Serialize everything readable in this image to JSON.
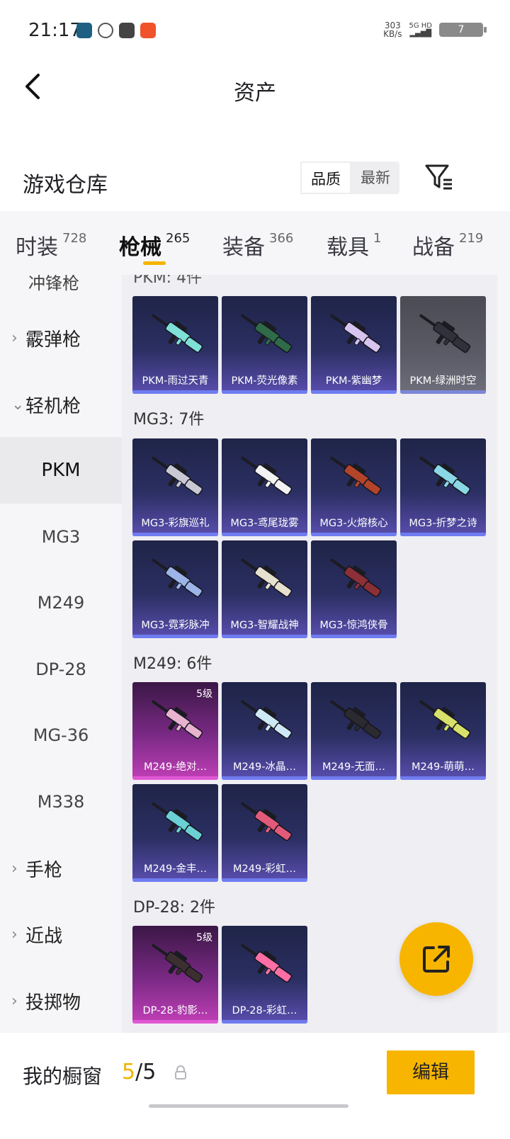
{
  "status_bar": {
    "time": "21:17",
    "net_speed_value": "303",
    "net_speed_unit": "KB/s",
    "signal": "5G HD",
    "battery": "7"
  },
  "nav": {
    "title": "资产"
  },
  "warehouse": {
    "title": "游戏仓库",
    "sort_options": [
      "品质",
      "最新"
    ],
    "sort_selected": "品质"
  },
  "tabs": [
    {
      "label": "时装",
      "count": "728"
    },
    {
      "label": "枪械",
      "count": "265"
    },
    {
      "label": "装备",
      "count": "366"
    },
    {
      "label": "载具",
      "count": "1"
    },
    {
      "label": "战备",
      "count": "219"
    }
  ],
  "active_tab": "枪械",
  "sidebar": {
    "partial_top": "冲锋枪",
    "groups": [
      {
        "label": "霰弹枪",
        "expanded": false
      },
      {
        "label": "轻机枪",
        "expanded": true
      },
      {
        "label": "手枪",
        "expanded": false
      },
      {
        "label": "近战",
        "expanded": false
      },
      {
        "label": "投掷物",
        "expanded": false
      }
    ],
    "sub_items": [
      "PKM",
      "MG3",
      "M249",
      "DP-28",
      "MG-36",
      "M338"
    ],
    "active_sub": "PKM"
  },
  "content": {
    "partial_section": "PKM: 4件",
    "sections": [
      {
        "title": "PKM: 4件",
        "items": [
          {
            "name": "PKM-雨过天青",
            "style": "purple",
            "tier": ""
          },
          {
            "name": "PKM-荧光像素",
            "style": "purple",
            "tier": ""
          },
          {
            "name": "PKM-紫幽梦",
            "style": "purple",
            "tier": ""
          },
          {
            "name": "PKM-绿洲时空",
            "style": "gray",
            "tier": ""
          }
        ]
      },
      {
        "title": "MG3: 7件",
        "items": [
          {
            "name": "MG3-彩旗巡礼",
            "style": "purple",
            "tier": ""
          },
          {
            "name": "MG3-鸢尾珑雾",
            "style": "purple",
            "tier": ""
          },
          {
            "name": "MG3-火熔核心",
            "style": "purple",
            "tier": ""
          },
          {
            "name": "MG3-折梦之诗",
            "style": "purple",
            "tier": ""
          },
          {
            "name": "MG3-霓彩脉冲",
            "style": "purple",
            "tier": ""
          },
          {
            "name": "MG3-智耀战神",
            "style": "purple",
            "tier": ""
          },
          {
            "name": "MG3-惊鸿侠骨",
            "style": "purple",
            "tier": ""
          }
        ]
      },
      {
        "title": "M249: 6件",
        "items": [
          {
            "name": "M249-绝对…",
            "style": "pink",
            "tier": "5级"
          },
          {
            "name": "M249-冰晶…",
            "style": "purple",
            "tier": ""
          },
          {
            "name": "M249-无面…",
            "style": "purple",
            "tier": ""
          },
          {
            "name": "M249-萌萌…",
            "style": "purple",
            "tier": ""
          },
          {
            "name": "M249-金丰…",
            "style": "purple",
            "tier": ""
          },
          {
            "name": "M249-彩虹…",
            "style": "purple",
            "tier": ""
          }
        ]
      },
      {
        "title": "DP-28: 2件",
        "items": [
          {
            "name": "DP-28-豹影…",
            "style": "pink",
            "tier": "5级"
          },
          {
            "name": "DP-28-彩虹…",
            "style": "purple",
            "tier": ""
          }
        ]
      }
    ]
  },
  "gun_colors": [
    "#7fe0d8",
    "#2f6b48",
    "#d7c4ef",
    "#30313a",
    "#c9c9d6",
    "#f2f2f2",
    "#b3442a",
    "#8ad8e6",
    "#9db4e8",
    "#e6e0cf",
    "#8c2f36",
    "#e7b3cf",
    "#cfe8f5",
    "#2a2a30",
    "#d7e06a",
    "#6bd0d6",
    "#e25a7a",
    "#3b2f30",
    "#ff6fa6"
  ],
  "showcase": {
    "label": "我的橱窗",
    "used": "5",
    "separator": "/",
    "total": "5",
    "edit_label": "编辑"
  },
  "colors": {
    "accent": "#f7b500",
    "card_purple": "#2b2f62",
    "card_pink": "#c13fb7",
    "card_gray": "#5a5b66"
  }
}
